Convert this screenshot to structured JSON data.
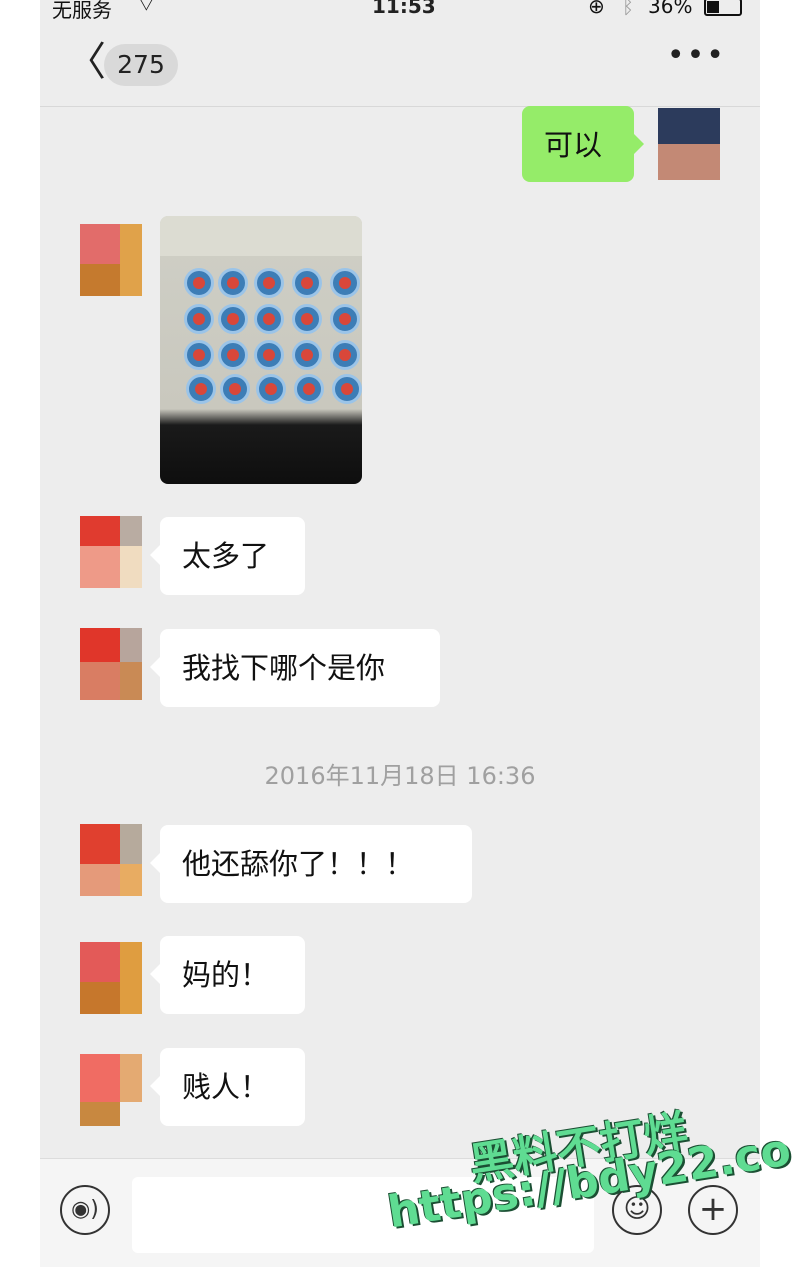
{
  "status_bar": {
    "carrier": "无服务",
    "wifi_icon": "wifi-icon",
    "time": "11:53",
    "lock_icon": "rotation-lock-icon",
    "bluetooth_icon": "bluetooth-icon",
    "battery_text": "36%",
    "battery_icon": "battery-icon"
  },
  "nav": {
    "back_glyph": "〈",
    "unread_count": "275",
    "more_glyph": "•••"
  },
  "messages": [
    {
      "side": "right",
      "type": "text",
      "text": "可以"
    },
    {
      "side": "left",
      "type": "image"
    },
    {
      "side": "left",
      "type": "text",
      "text": "太多了"
    },
    {
      "side": "left",
      "type": "text",
      "text": "我找下哪个是你"
    },
    {
      "side": "left",
      "type": "text",
      "text": "他还舔你了！！！"
    },
    {
      "side": "left",
      "type": "text",
      "text": "妈的！"
    },
    {
      "side": "left",
      "type": "text",
      "text": "贱人！"
    }
  ],
  "timestamp": "2016年11月18日 16:36",
  "bottom_bar": {
    "voice_glyph": "◉)",
    "emoji_glyph": "☺",
    "plus_glyph": "+"
  },
  "watermark": {
    "line1": "黑料不打烊",
    "line2": "https://bdy22.co"
  },
  "colors": {
    "chat_background": "#ededed",
    "sent_bubble": "#95ec69",
    "received_bubble": "#ffffff"
  }
}
